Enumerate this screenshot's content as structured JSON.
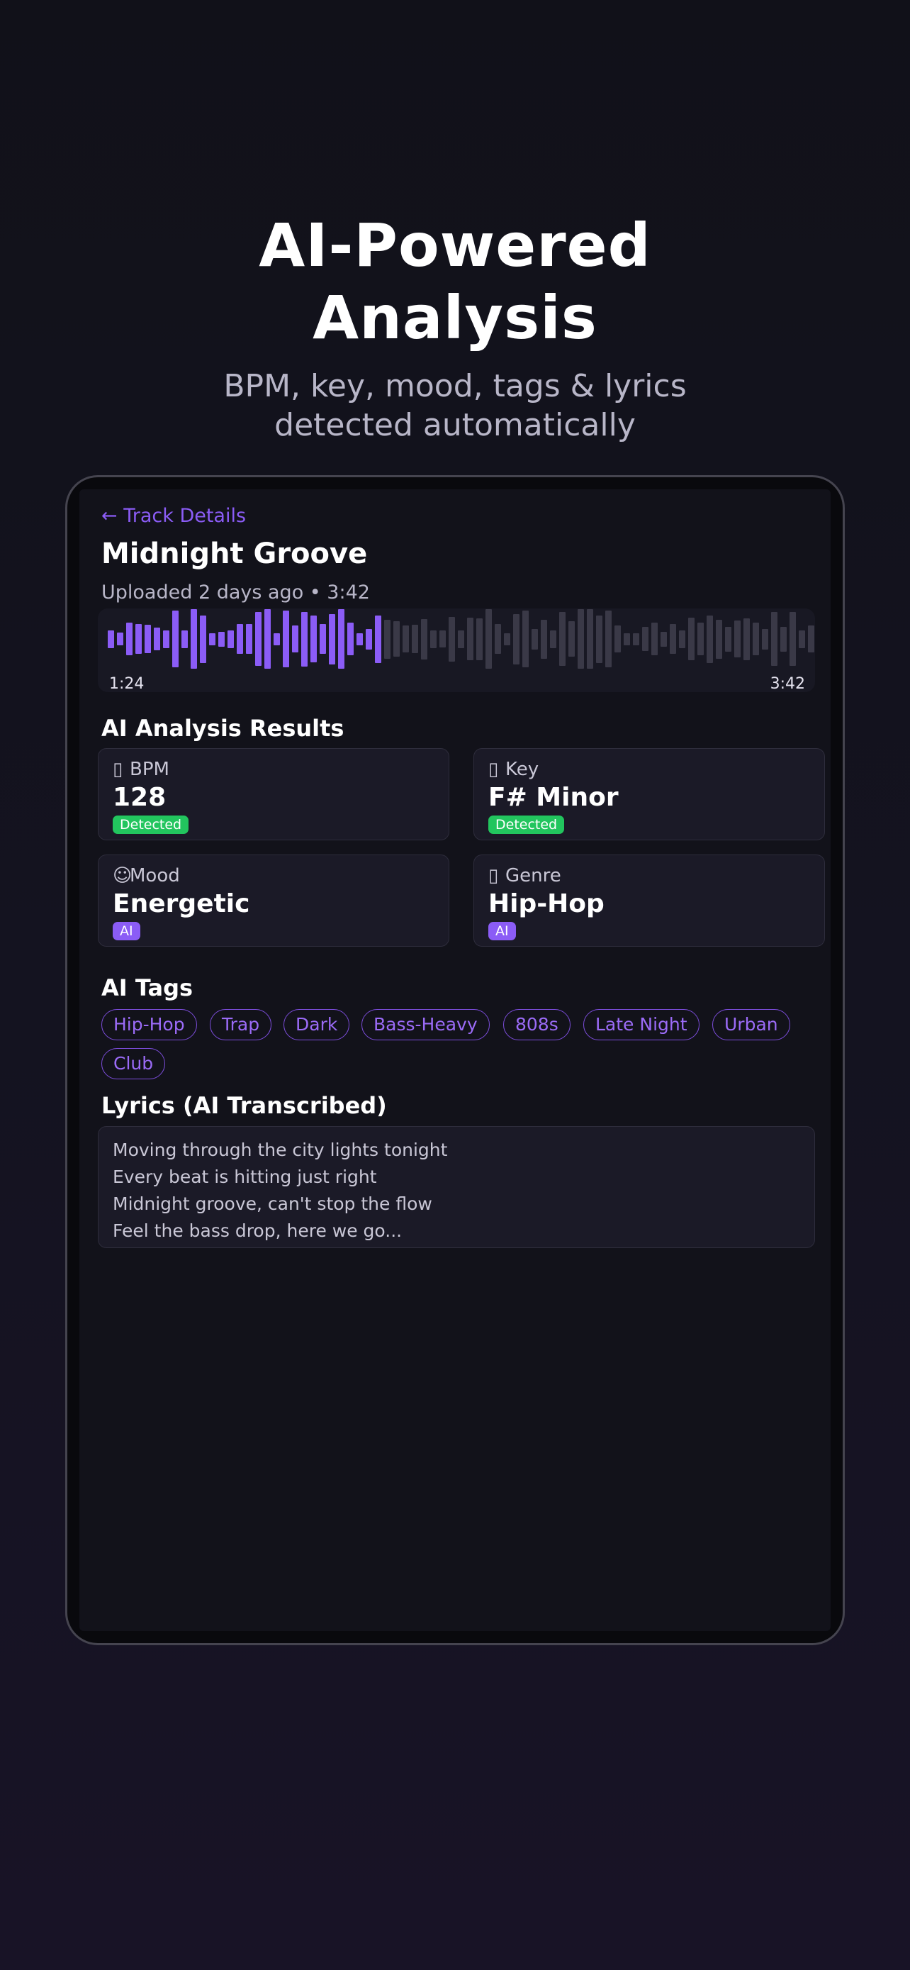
{
  "hero": {
    "title_line1": "AI-Powered",
    "title_line2": "Analysis",
    "subtitle_line1": "BPM, key, mood, tags & lyrics",
    "subtitle_line2": "detected automatically"
  },
  "header": {
    "back_label": "← Track Details",
    "track_title": "Midnight Groove",
    "track_meta": "Uploaded 2 days ago • 3:42"
  },
  "player": {
    "current_time": "1:24",
    "duration": "3:42",
    "progress_fraction": 0.38,
    "waveform_levels": [
      0.3,
      0.22,
      0.55,
      0.5,
      0.48,
      0.38,
      0.3,
      0.95,
      0.3,
      1.0,
      0.8,
      0.2,
      0.25,
      0.3,
      0.5,
      0.5,
      0.9,
      1.0,
      0.2,
      0.95,
      0.45,
      0.92,
      0.78,
      0.5,
      0.85,
      1.0,
      0.55,
      0.2,
      0.35,
      0.8,
      0.65,
      0.6,
      0.45,
      0.48,
      0.68,
      0.3,
      0.28,
      0.75,
      0.3,
      0.72,
      0.7,
      1.0,
      0.5,
      0.2,
      0.85,
      0.95,
      0.35,
      0.65,
      0.3,
      0.9,
      0.6,
      1.0,
      1.0,
      0.8,
      0.95,
      0.45,
      0.2,
      0.2,
      0.4,
      0.55,
      0.25,
      0.5,
      0.3,
      0.72,
      0.55,
      0.8,
      0.65,
      0.42,
      0.62,
      0.7,
      0.55,
      0.35,
      0.9,
      0.42,
      0.9,
      0.3,
      0.45,
      0.8,
      0.7
    ],
    "played_color": "#8b5cf6",
    "unplayed_color": "#3a3947"
  },
  "analysis": {
    "title": "AI Analysis Results",
    "cards": [
      {
        "icon": "metronome-icon",
        "label": "BPM",
        "value": "128",
        "badge": "Detected",
        "badge_color": "#22c55e"
      },
      {
        "icon": "music-note-icon",
        "label": "Key",
        "value": "F# Minor",
        "badge": "Detected",
        "badge_color": "#22c55e"
      },
      {
        "icon": "smiley-icon",
        "label": "Mood",
        "value": "Energetic",
        "badge": "AI",
        "badge_color": "#8b5cf6"
      },
      {
        "icon": "guitar-icon",
        "label": "Genre",
        "value": "Hip-Hop",
        "badge": "AI",
        "badge_color": "#8b5cf6"
      }
    ]
  },
  "tags": {
    "title": "AI Tags",
    "items": [
      "Hip-Hop",
      "Trap",
      "Dark",
      "Bass-Heavy",
      "808s",
      "Late Night",
      "Urban",
      "Club"
    ]
  },
  "lyrics": {
    "title": "Lyrics (AI Transcribed)",
    "lines": [
      "Moving through the city lights tonight",
      "Every beat is hitting just right",
      "Midnight groove, can't stop the flow",
      "Feel the bass drop, here we go..."
    ]
  },
  "colors": {
    "accent": "#8b5cf6",
    "success": "#22c55e"
  }
}
